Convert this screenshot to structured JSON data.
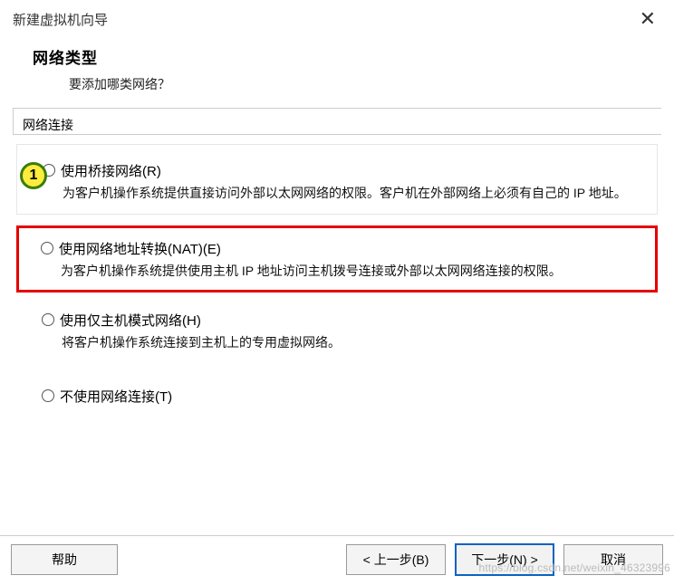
{
  "window": {
    "title": "新建虚拟机向导",
    "close": "✕"
  },
  "header": {
    "title": "网络类型",
    "subtitle": "要添加哪类网络？"
  },
  "section_label": "网络连接",
  "badge": "1",
  "options": {
    "bridged": {
      "label": "使用桥接网络(R)",
      "desc": "为客户机操作系统提供直接访问外部以太网网络的权限。客户机在外部网络上必须有自己的 IP 地址。"
    },
    "nat": {
      "label": "使用网络地址转换(NAT)(E)",
      "desc": "为客户机操作系统提供使用主机 IP 地址访问主机拨号连接或外部以太网网络连接的权限。"
    },
    "hostonly": {
      "label": "使用仅主机模式网络(H)",
      "desc": "将客户机操作系统连接到主机上的专用虚拟网络。"
    },
    "none": {
      "label": "不使用网络连接(T)"
    }
  },
  "buttons": {
    "help": "帮助",
    "back": "< 上一步(B)",
    "next": "下一步(N) >",
    "cancel": "取消"
  },
  "watermark": "https://blog.csdn.net/weixin_46323996"
}
